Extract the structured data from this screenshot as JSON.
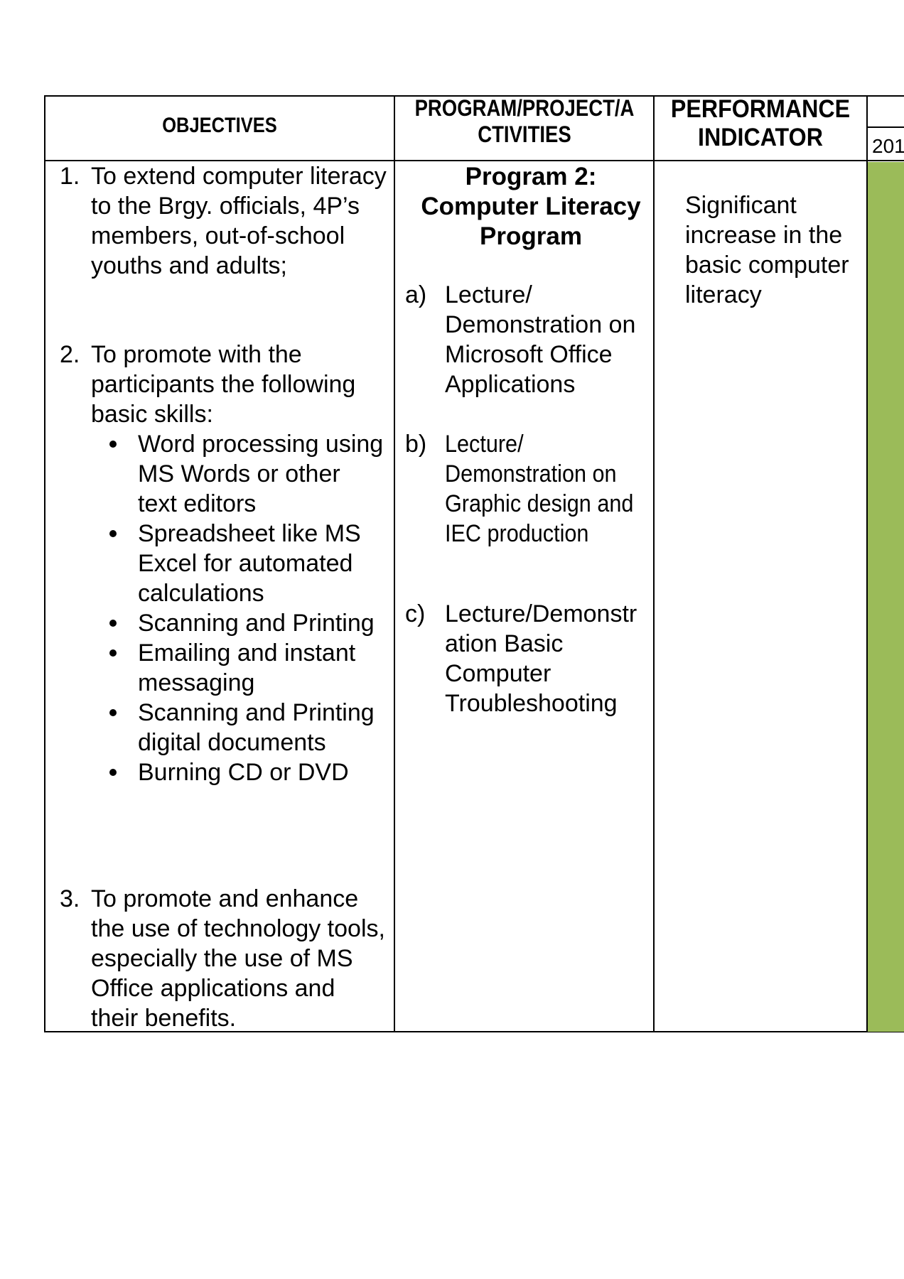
{
  "headers": {
    "objectives": "OBJECTIVES",
    "program": "PROGRAM/PROJECT/A CTIVITIES",
    "performance": "PERFORMANCE INDICATOR",
    "year": "201"
  },
  "objectives": {
    "item1_num": "1.",
    "item1_text": "To extend computer literacy to the Brgy. officials, 4P’s members, out-of-school youths and adults;",
    "item2_num": "2.",
    "item2_text": "To promote with the participants the following basic skills:",
    "skills": [
      "Word processing using MS Words or other text editors",
      "Spreadsheet like MS Excel for automated calculations",
      "Scanning and Printing",
      "Emailing and instant messaging",
      "Scanning and Printing digital documents",
      "Burning CD or DVD"
    ],
    "item3_num": "3.",
    "item3_text": "To promote and enhance the use of technology tools, especially the use of MS Office applications and their benefits."
  },
  "program": {
    "title": "Program 2: Computer Literacy Program",
    "activities": [
      {
        "letter": "a)",
        "text": "Lecture/ Demonstration on Microsoft Office Applications"
      },
      {
        "letter": "b)",
        "text": "Lecture/ Demonstration on Graphic design and IEC production"
      },
      {
        "letter": "c)",
        "text": "Lecture/Demonstr ation Basic Computer Troubleshooting"
      }
    ]
  },
  "performance": {
    "indicator": "Significant increase in the basic computer literacy"
  },
  "colors": {
    "green_column": "#9bbb59"
  }
}
